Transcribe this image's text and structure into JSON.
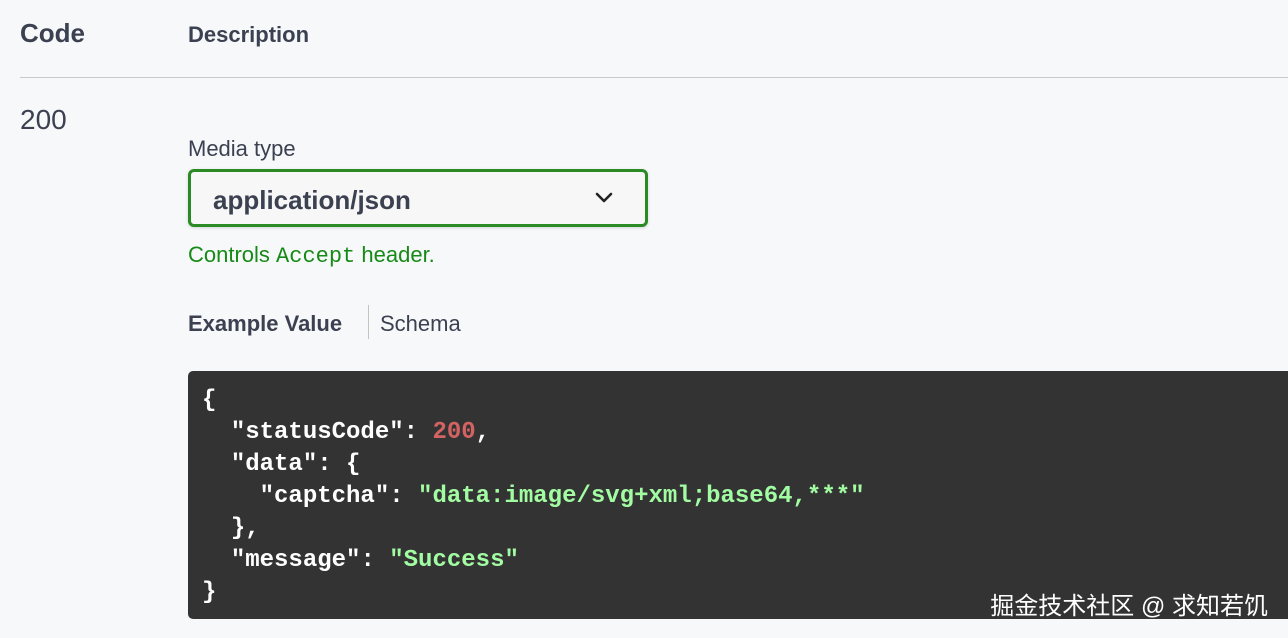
{
  "table": {
    "headers": {
      "code": "Code",
      "description": "Description"
    },
    "response": {
      "code": "200"
    }
  },
  "media_type": {
    "label": "Media type",
    "selected": "application/json",
    "note_prefix": "Controls",
    "note_code": "Accept",
    "note_suffix": "header."
  },
  "tabs": {
    "example": "Example Value",
    "schema": "Schema"
  },
  "example_json": {
    "open_brace": "{",
    "status_key": "\"statusCode\"",
    "status_value": "200",
    "data_key": "\"data\"",
    "captcha_key": "\"captcha\"",
    "captcha_value": "\"data:image/svg+xml;base64,***\"",
    "data_close": "},",
    "message_key": "\"message\"",
    "message_value": "\"Success\"",
    "close_brace": "}"
  },
  "watermark": "掘金技术社区 @ 求知若饥",
  "colors": {
    "accent_green": "#2a8a24",
    "note_green": "#168a16",
    "code_bg": "#333333",
    "number": "#d36363",
    "string": "#a2fca2"
  },
  "icons": {
    "select_chevron": "chevron-down-icon"
  }
}
